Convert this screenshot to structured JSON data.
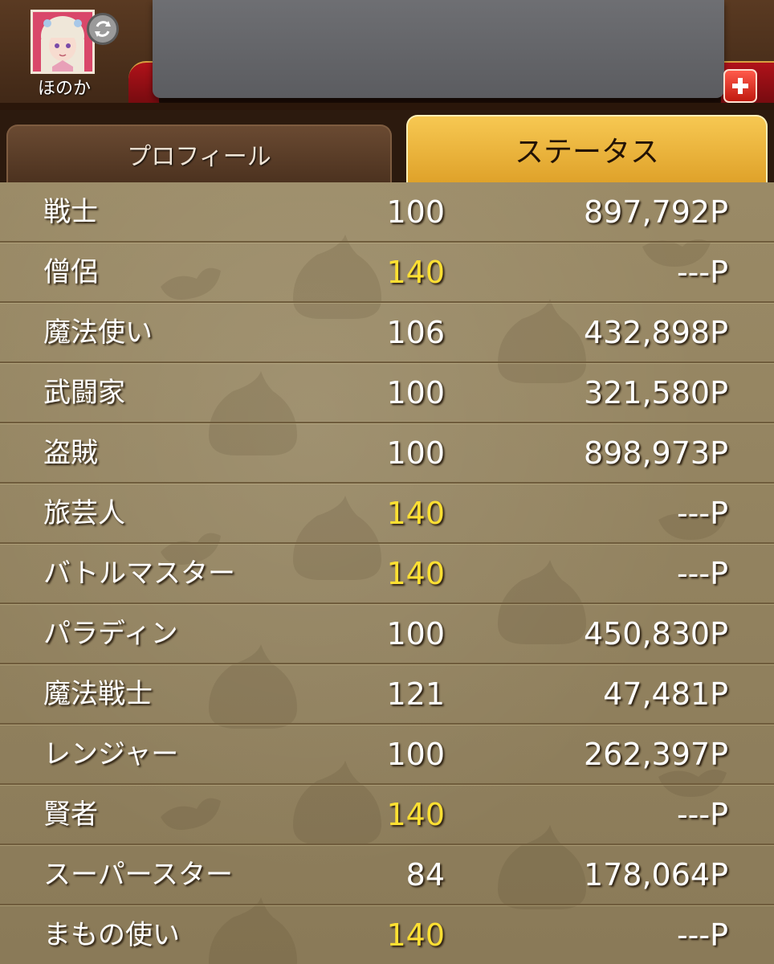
{
  "header": {
    "character_name": "ほのか",
    "avatar_icon": "character-avatar",
    "swap_icon": "swap-character-icon",
    "plus_icon": "plus-icon"
  },
  "tabs": [
    {
      "label": "プロフィール",
      "active": false
    },
    {
      "label": "ステータス",
      "active": true
    }
  ],
  "colors": {
    "max_level": "#ffe033",
    "normal_text": "#ffffff",
    "active_tab": "#f2b83a",
    "header_red": "#9e0f16"
  },
  "jobs": [
    {
      "name": "戦士",
      "level": "100",
      "points": "897,792P",
      "max": false
    },
    {
      "name": "僧侶",
      "level": "140",
      "points": "---P",
      "max": true
    },
    {
      "name": "魔法使い",
      "level": "106",
      "points": "432,898P",
      "max": false
    },
    {
      "name": "武闘家",
      "level": "100",
      "points": "321,580P",
      "max": false
    },
    {
      "name": "盗賊",
      "level": "100",
      "points": "898,973P",
      "max": false
    },
    {
      "name": "旅芸人",
      "level": "140",
      "points": "---P",
      "max": true
    },
    {
      "name": "バトルマスター",
      "level": "140",
      "points": "---P",
      "max": true
    },
    {
      "name": "パラディン",
      "level": "100",
      "points": "450,830P",
      "max": false
    },
    {
      "name": "魔法戦士",
      "level": "121",
      "points": "47,481P",
      "max": false
    },
    {
      "name": "レンジャー",
      "level": "100",
      "points": "262,397P",
      "max": false
    },
    {
      "name": "賢者",
      "level": "140",
      "points": "---P",
      "max": true
    },
    {
      "name": "スーパースター",
      "level": "84",
      "points": "178,064P",
      "max": false
    },
    {
      "name": "まもの使い",
      "level": "140",
      "points": "---P",
      "max": true
    }
  ]
}
